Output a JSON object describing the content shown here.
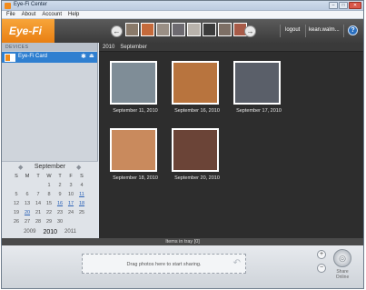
{
  "window": {
    "title": "Eye-Fi Center",
    "minimize": "–",
    "maximize": "□",
    "close": "✕"
  },
  "menu": [
    "File",
    "About",
    "Account",
    "Help"
  ],
  "header": {
    "logo": "Eye-Fi",
    "prev_icon": "arrow-left-icon",
    "next_icon": "arrow-right-icon",
    "prev_glyph": "←",
    "next_glyph": "→",
    "strip_colors": [
      "#8a7a6a",
      "#c56a3b",
      "#9a8f85",
      "#6d6a70",
      "#b9b3ac",
      "#3b3b3b",
      "#7d6f65",
      "#a85b48"
    ],
    "logout": "logout",
    "account": "kean.walm...",
    "help": "?"
  },
  "sidebar": {
    "devices_heading": "DEVICES",
    "device": {
      "label": "Eye-Fi Card",
      "gear": "✱",
      "eject": "⏏"
    }
  },
  "calendar": {
    "prev": "◆",
    "next": "◆",
    "month": "September",
    "dow": [
      "S",
      "M",
      "T",
      "W",
      "T",
      "F",
      "S"
    ],
    "days": [
      "",
      "",
      "",
      "1",
      "2",
      "3",
      "4",
      "5",
      "6",
      "7",
      "8",
      "9",
      "10",
      "11",
      "12",
      "13",
      "14",
      "15",
      "16",
      "17",
      "18",
      "19",
      "20",
      "21",
      "22",
      "23",
      "24",
      "25",
      "26",
      "27",
      "28",
      "29",
      "30",
      "",
      ""
    ],
    "active_days": [
      "11",
      "16",
      "17",
      "18",
      "20"
    ],
    "years": [
      "2009",
      "2010",
      "2011"
    ],
    "current_year": "2010"
  },
  "breadcrumb": [
    "2010",
    "September"
  ],
  "photos": [
    {
      "label": "September 11, 2010",
      "color": "#7f8d97"
    },
    {
      "label": "September 16, 2010",
      "color": "#b8743e"
    },
    {
      "label": "September 17, 2010",
      "color": "#5a5f69"
    },
    {
      "label": "September 18, 2010",
      "color": "#c98a5d"
    },
    {
      "label": "September 20, 2010",
      "color": "#6b4437"
    }
  ],
  "tray": {
    "header": "Items in tray [0]",
    "drop_text": "Drag photos here to start sharing.",
    "drop_arrow": "↶",
    "zoom_in": "+",
    "zoom_out": "−",
    "share_glyph": "◎",
    "share_label": "Share Online"
  }
}
